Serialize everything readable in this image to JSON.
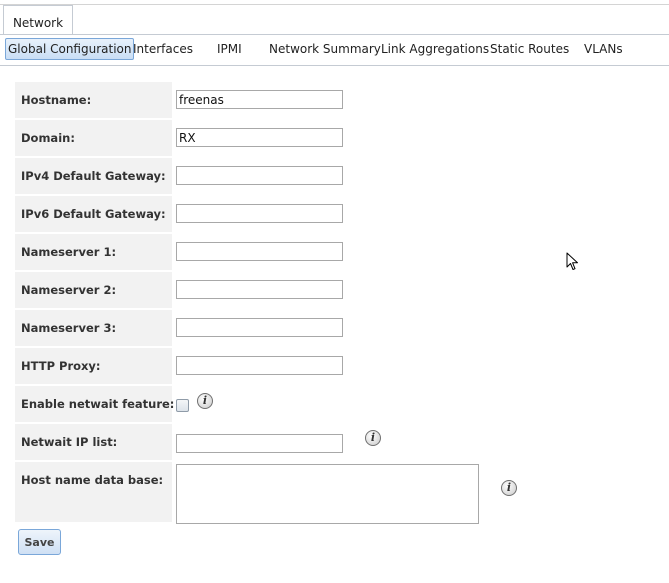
{
  "outer_tab": {
    "label": "Network"
  },
  "subtabs": [
    {
      "label": "Global Configuration",
      "active": true
    },
    {
      "label": "Interfaces"
    },
    {
      "label": "IPMI"
    },
    {
      "label": "Network Summary"
    },
    {
      "label": "Link Aggregations"
    },
    {
      "label": "Static Routes"
    },
    {
      "label": "VLANs"
    }
  ],
  "form": {
    "hostname": {
      "label": "Hostname:",
      "value": "freenas"
    },
    "domain": {
      "label": "Domain:",
      "value": "RX"
    },
    "ipv4_gateway": {
      "label": "IPv4 Default Gateway:",
      "value": ""
    },
    "ipv6_gateway": {
      "label": "IPv6 Default Gateway:",
      "value": ""
    },
    "nameserver1": {
      "label": "Nameserver 1:",
      "value": ""
    },
    "nameserver2": {
      "label": "Nameserver 2:",
      "value": ""
    },
    "nameserver3": {
      "label": "Nameserver 3:",
      "value": ""
    },
    "http_proxy": {
      "label": "HTTP Proxy:",
      "value": ""
    },
    "netwait_enable": {
      "label": "Enable netwait feature:",
      "checked": false
    },
    "netwait_ip_list": {
      "label": "Netwait IP list:",
      "value": ""
    },
    "host_db": {
      "label": "Host name data base:",
      "value": ""
    }
  },
  "info_icon_glyph": "i",
  "save": {
    "label": "Save"
  },
  "icons": [
    "info-icon",
    "mouse-cursor-icon"
  ],
  "colors": {
    "accent": "#7aa7d9",
    "label_bg": "#f2f2f2",
    "border": "#c5cbd3"
  }
}
